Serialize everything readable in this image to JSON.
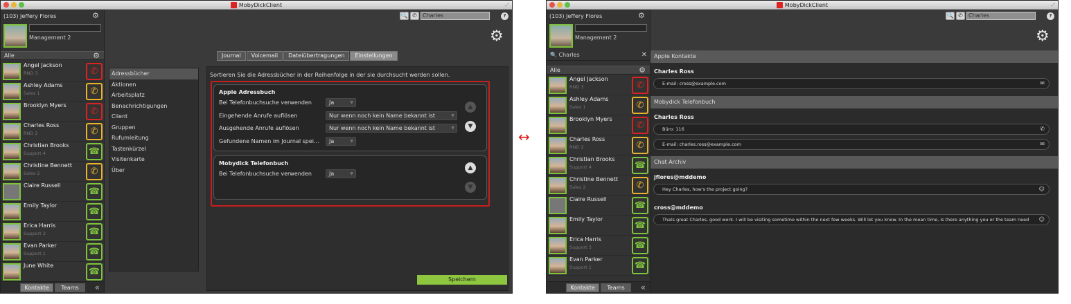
{
  "app_title": "MobyDickClient",
  "user": {
    "name": "(103) Jeffery Flores",
    "group": "Management 2"
  },
  "search": {
    "value": "Charles"
  },
  "contacts_header": "Alle",
  "contacts": [
    {
      "name": "Angel Jackson",
      "sub": "RND 3",
      "status": "red"
    },
    {
      "name": "Ashley Adams",
      "sub": "Sales 1",
      "status": "yel"
    },
    {
      "name": "Brooklyn Myers",
      "sub": "",
      "status": "red"
    },
    {
      "name": "Charles Ross",
      "sub": "RND 2",
      "status": "yel"
    },
    {
      "name": "Christian Brooks",
      "sub": "Support 4",
      "status": "grn"
    },
    {
      "name": "Christine Bennett",
      "sub": "Sales 2",
      "status": "yel"
    },
    {
      "name": "Claire Russell",
      "sub": "",
      "status": "grn"
    },
    {
      "name": "Emily Taylor",
      "sub": "",
      "status": "grn"
    },
    {
      "name": "Erica Harris",
      "sub": "Support 3",
      "status": "grn"
    },
    {
      "name": "Evan Parker",
      "sub": "Support 1",
      "status": "grn"
    },
    {
      "name": "June White",
      "sub": "",
      "status": "grn"
    }
  ],
  "footer_tabs": {
    "contacts": "Kontakte",
    "teams": "Teams"
  },
  "main_tabs": [
    "Journal",
    "Voicemail",
    "Dateiübertragungen",
    "Einstellungen"
  ],
  "categories": [
    "Adressbücher",
    "Aktionen",
    "Arbeitsplatz",
    "Benachrichtigungen",
    "Client",
    "Gruppen",
    "Rufumleitung",
    "Tastenkürzel",
    "Visitenkarte",
    "Über"
  ],
  "settings": {
    "intro": "Sortieren Sie die Adressbücher in der Reihenfolge in der sie durchsucht werden sollen.",
    "apple": {
      "title": "Apple Adressbuch",
      "rows": [
        {
          "label": "Bei Telefonbuchsuche verwenden",
          "value": "Ja"
        },
        {
          "label": "Eingehende Anrufe auflösen",
          "value": "Nur wenn noch kein Name bekannt ist"
        },
        {
          "label": "Ausgehende Anrufe auflösen",
          "value": "Nur wenn noch kein Name bekannt ist"
        },
        {
          "label": "Gefundene Namen im Journal spei...",
          "value": "Ja"
        }
      ]
    },
    "moby": {
      "title": "Mobydick Telefonbuch",
      "rows": [
        {
          "label": "Bei Telefonbuchsuche verwenden",
          "value": "Ja"
        }
      ]
    },
    "save": "Speichern"
  },
  "right": {
    "search_label": "Charles",
    "sections": {
      "apple": "Apple Kontakte",
      "moby": "Mobydick Telefonbuch",
      "chat": "Chat Archiv"
    },
    "apple_name": "Charles Ross",
    "apple_email": "E-mail: cross@example.com",
    "moby_name": "Charles Ross",
    "moby_office": "Büro: 116",
    "moby_email": "E-mail: charles.ross@example.com",
    "chat1_user": "jflores@mddemo",
    "chat1_msg": "Hey Charles, how's the project going?",
    "chat2_user": "cross@mddemo",
    "chat2_msg": "Thats great Charles, good work. I will be visiting sometime within the next few weeks. Will let you know. In the mean time, is there anything you or the team need"
  }
}
